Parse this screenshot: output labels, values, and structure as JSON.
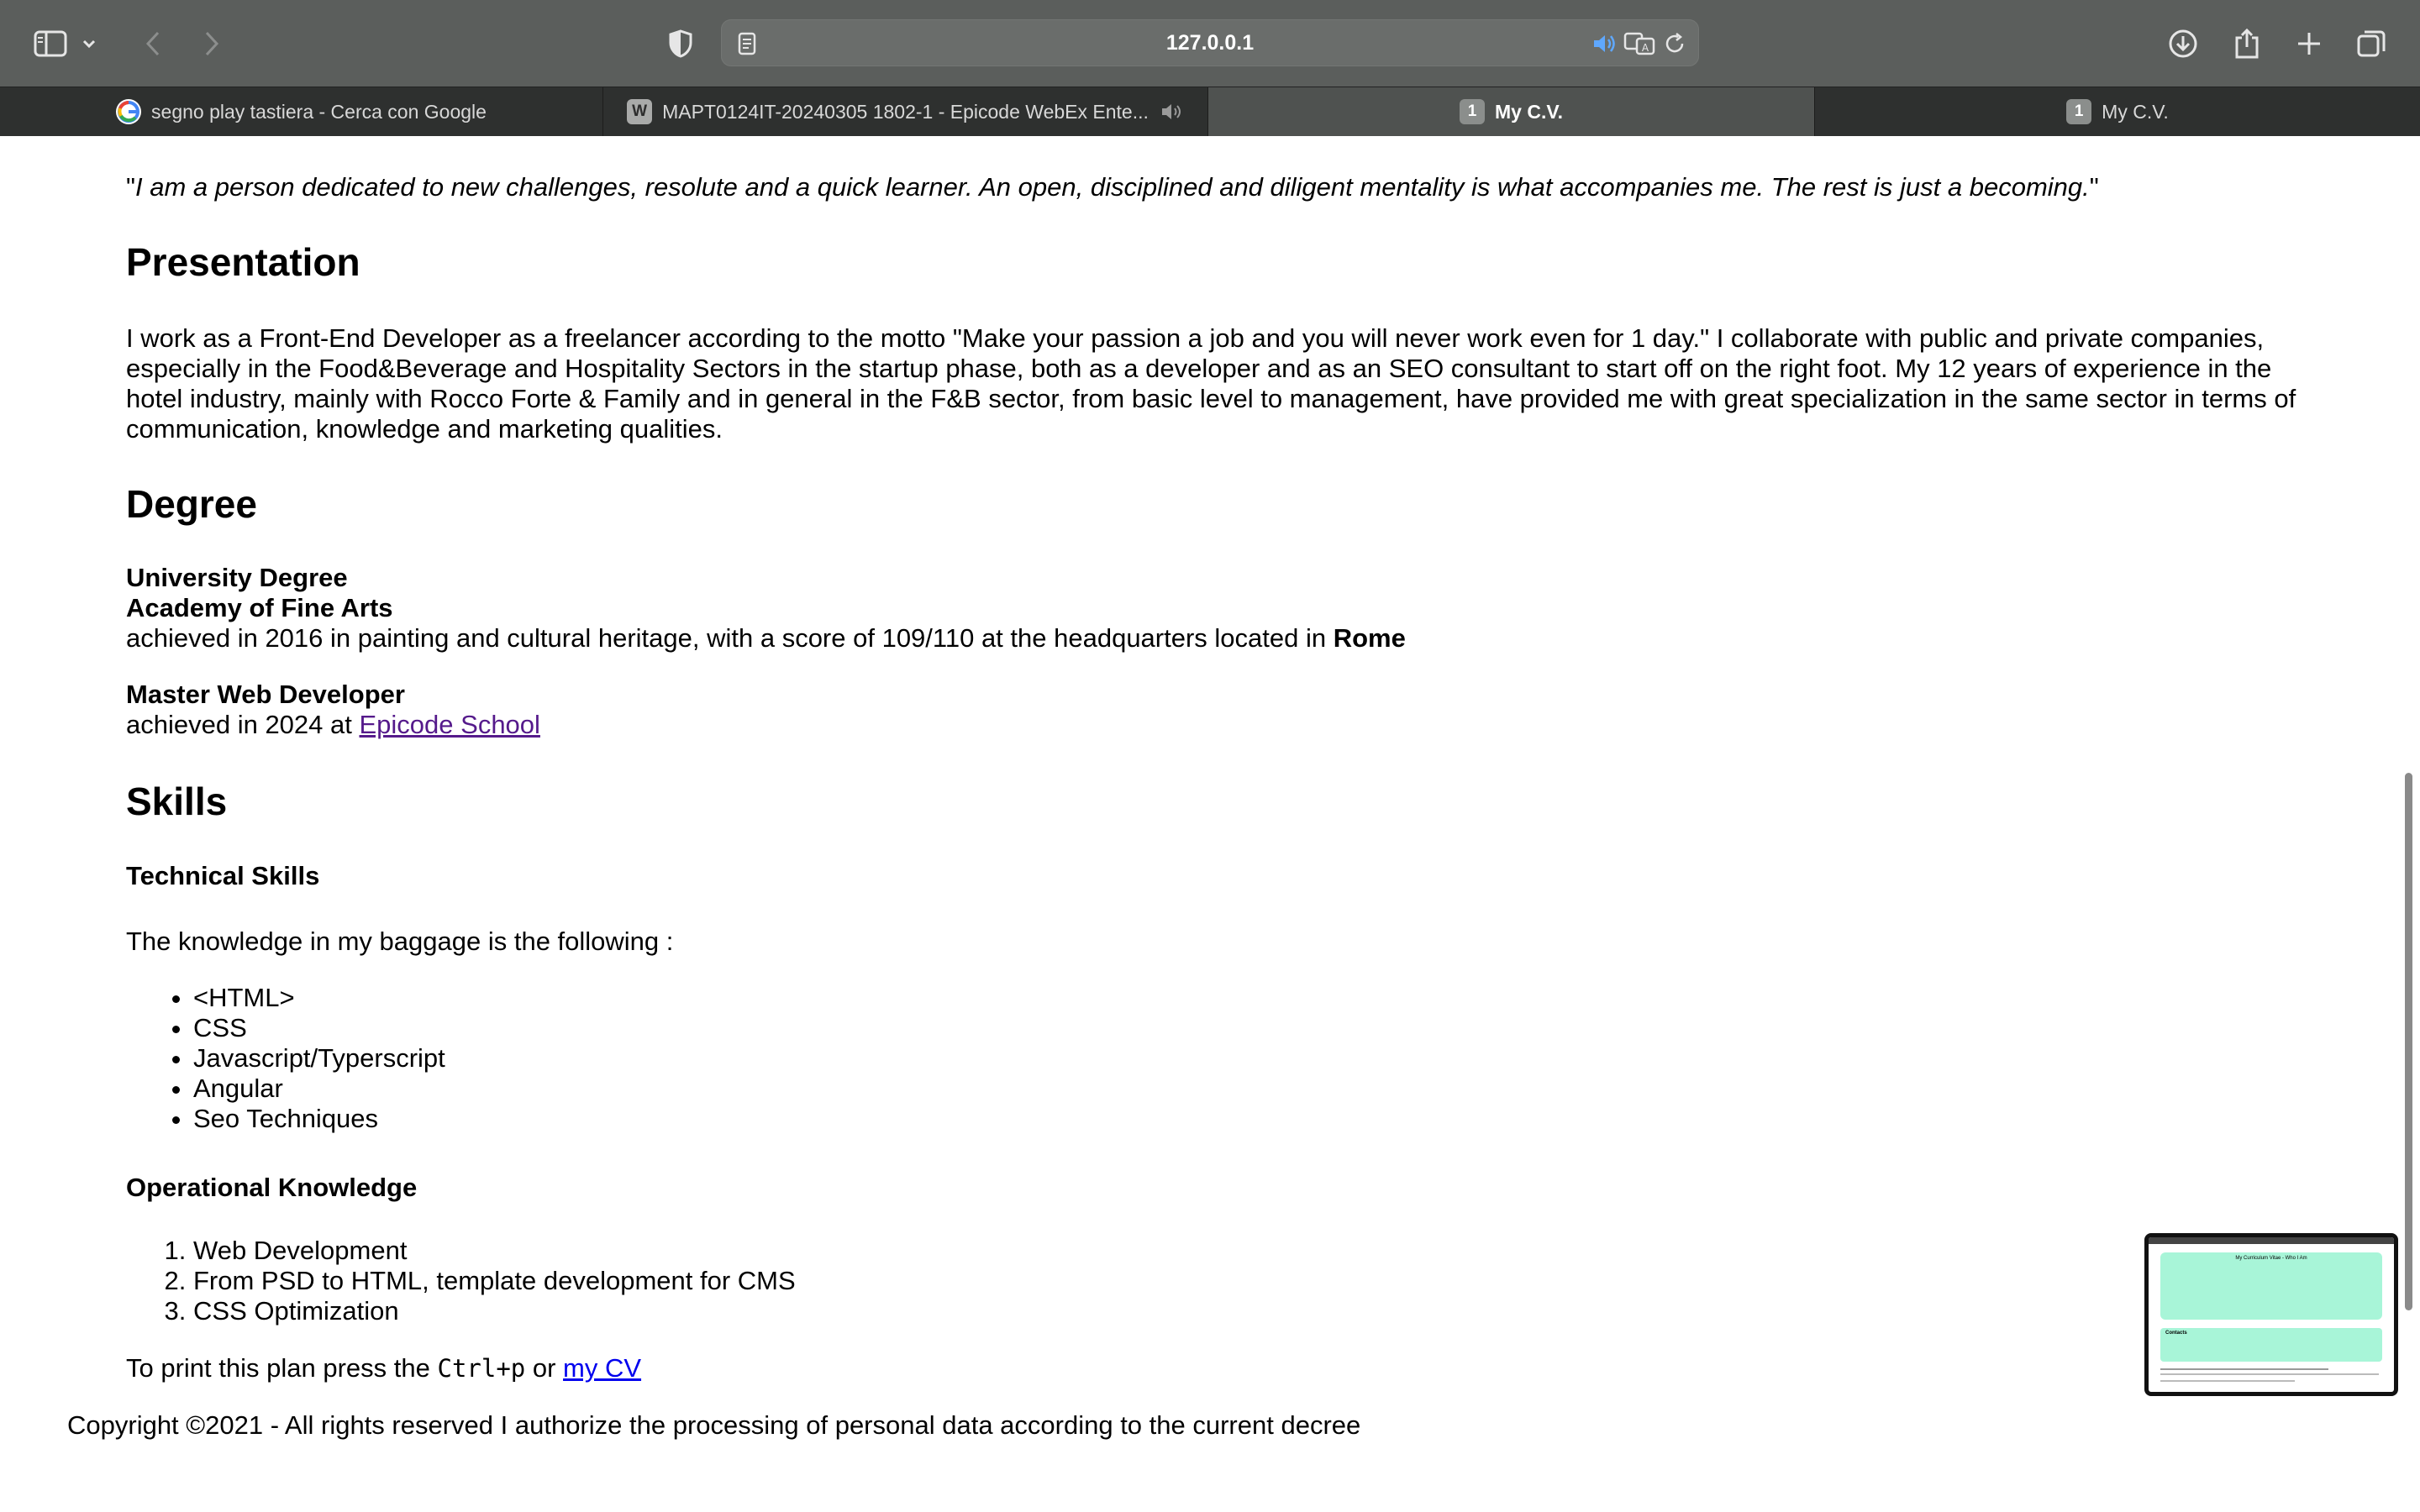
{
  "browser": {
    "url": "127.0.0.1",
    "tabs": [
      {
        "label": "segno play tastiera - Cerca con Google",
        "favicon": "G"
      },
      {
        "label": "MAPT0124IT-20240305 1802-1 - Epicode WebEx Ente...",
        "favicon": "W"
      },
      {
        "label": "My C.V.",
        "favicon": "1"
      },
      {
        "label": "My C.V.",
        "favicon": "1"
      }
    ]
  },
  "page": {
    "quote_mark_open": "\"",
    "quote": "I am a person dedicated to new challenges, resolute and a quick learner. An open, disciplined and diligent mentality is what accompanies me. The rest is just a becoming.",
    "quote_mark_close": "\"",
    "presentation": {
      "title": "Presentation",
      "text": "I work as a Front-End Developer as a freelancer according to the motto \"Make your passion a job and you will never work even for 1 day.\" I collaborate with public and private companies, especially in the Food&Beverage and Hospitality Sectors in the startup phase, both as a developer and as an SEO consultant to start off on the right foot. My 12 years of experience in the hotel industry, mainly with Rocco Forte & Family and in general in the F&B sector, from basic level to management, have provided me with great specialization in the same sector in terms of communication, knowledge and marketing qualities."
    },
    "degree": {
      "title": "Degree",
      "university_title": "University Degree",
      "academy": "Academy of Fine Arts",
      "academy_text": "achieved in 2016 in painting and cultural heritage, with a score of 109/110 at the headquarters located in ",
      "academy_city": "Rome",
      "master_title": "Master Web Developer",
      "master_text": "achieved in 2024 at ",
      "master_school": "Epicode School"
    },
    "skills": {
      "title": "Skills",
      "technical_title": "Technical Skills",
      "technical_intro": "The knowledge in my baggage is the following :",
      "technical_list": [
        "<HTML>",
        "CSS",
        "Javascript/Typerscript",
        "Angular",
        "Seo Techniques"
      ],
      "operational_title": "Operational Knowledge",
      "operational_list": [
        "Web Development",
        "From PSD to HTML, template development for CMS",
        "CSS Optimization"
      ]
    },
    "print_prefix": "To print this plan press the ",
    "print_key": "Ctrl+p",
    "print_or": " or ",
    "print_link": "my CV",
    "footer": "Copyright ©2021 - All rights reserved I authorize the processing of personal data according to the current decree"
  },
  "preview": {
    "title": "My Curriculum Vitae - Who I Am",
    "section": "Contacts"
  },
  "colors": {
    "toolbar": "#5b5e5c",
    "tabbar": "#2e302f",
    "link": "#0000ee",
    "link_visited": "#551a8b",
    "preview_accent": "#a8f5d8"
  }
}
